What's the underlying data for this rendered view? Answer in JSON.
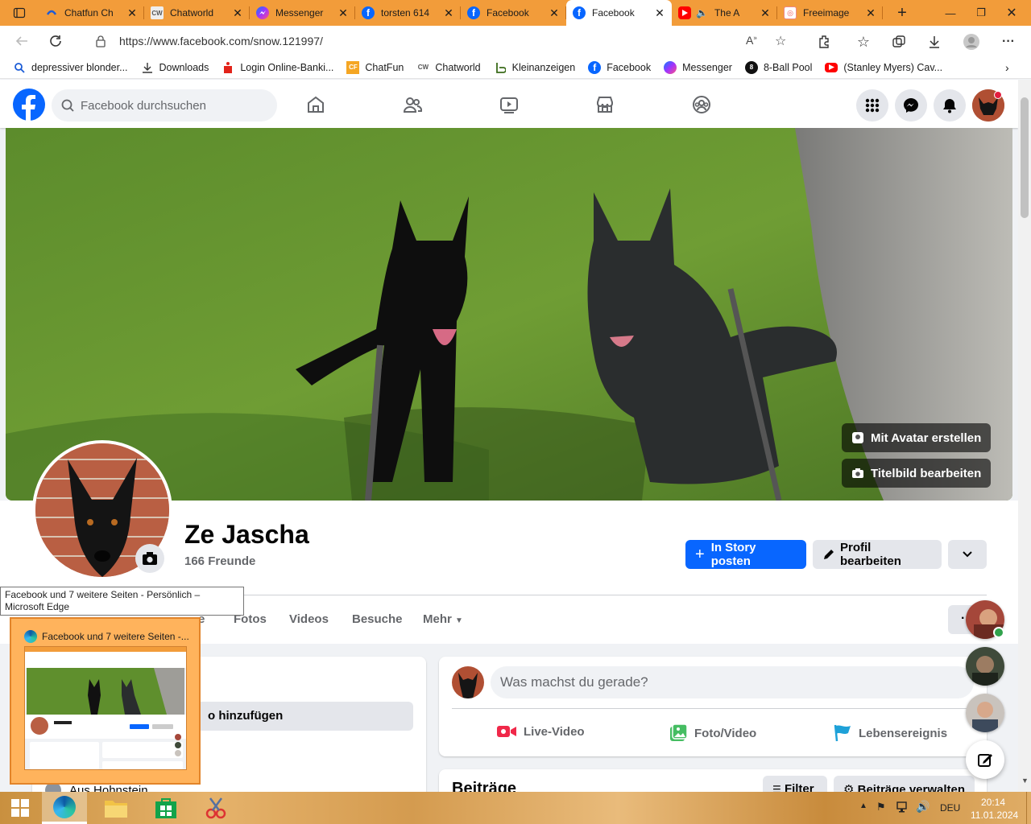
{
  "browser": {
    "tabs": [
      {
        "title": "Chatfun Ch",
        "icon": "chatfun-icon"
      },
      {
        "title": "Chatworld",
        "icon": "chatworld-icon"
      },
      {
        "title": "Messenger",
        "icon": "messenger-icon"
      },
      {
        "title": "torsten 614",
        "icon": "facebook-icon"
      },
      {
        "title": "Facebook",
        "icon": "facebook-icon"
      },
      {
        "title": "Facebook",
        "icon": "facebook-icon",
        "active": true
      },
      {
        "title": "The A",
        "icon": "youtube-icon"
      },
      {
        "title": "Freeimage",
        "icon": "freeimage-icon"
      }
    ],
    "url": "https://www.facebook.com/snow.121997/",
    "favorites": [
      {
        "label": "depressiver blonder...",
        "icon": "search-icon"
      },
      {
        "label": "Downloads",
        "icon": "download-icon"
      },
      {
        "label": "Login Online-Banki...",
        "icon": "bank-icon"
      },
      {
        "label": "ChatFun",
        "icon": "chatfun-icon"
      },
      {
        "label": "Chatworld",
        "icon": "chatworld-icon"
      },
      {
        "label": "Kleinanzeigen",
        "icon": "kleinanzeigen-icon"
      },
      {
        "label": "Facebook",
        "icon": "facebook-icon"
      },
      {
        "label": "Messenger",
        "icon": "messenger-icon"
      },
      {
        "label": "8-Ball Pool",
        "icon": "eight-ball-icon"
      },
      {
        "label": "(Stanley Myers) Cav...",
        "icon": "youtube-icon"
      }
    ]
  },
  "fb": {
    "search_placeholder": "Facebook durchsuchen",
    "cover_buttons": {
      "avatar": "Mit Avatar erstellen",
      "edit_cover": "Titelbild bearbeiten"
    },
    "profile": {
      "name": "Ze Jascha",
      "friends": "166 Freunde"
    },
    "buttons": {
      "story": "In Story posten",
      "edit_profile": "Profil bearbeiten"
    },
    "tabs": [
      "e",
      "Fotos",
      "Videos",
      "Besuche",
      "Mehr"
    ],
    "intro": {
      "add_button": "o hinzufügen",
      "location": "Aus Hohnstein"
    },
    "composer": {
      "placeholder": "Was machst du gerade?"
    },
    "post_actions": [
      "Live-Video",
      "Foto/Video",
      "Lebensereignis"
    ],
    "posts": {
      "title": "Beiträge",
      "filter": "Filter",
      "manage": "Beiträge verwalten"
    }
  },
  "tooltip": {
    "text": "Facebook und 7 weitere Seiten - Persönlich – Microsoft Edge"
  },
  "thumbnail": {
    "title": "Facebook und 7 weitere Seiten -..."
  },
  "taskbar": {
    "lang": "DEU",
    "time": "20:14",
    "date": "11.01.2024"
  },
  "colors": {
    "fb_blue": "#0866ff",
    "tabbar": "#f29c3a",
    "active_tab": "#ffffff"
  }
}
